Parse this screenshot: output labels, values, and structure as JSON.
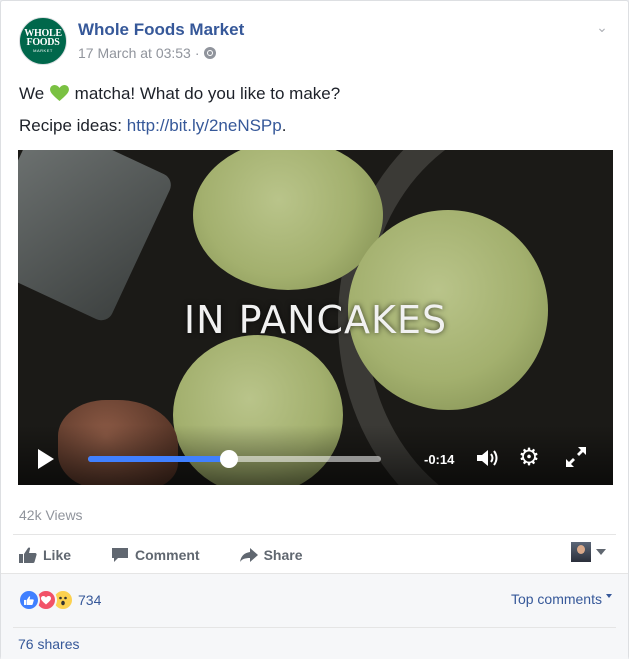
{
  "post": {
    "page_name": "Whole Foods Market",
    "timestamp": "17 March at 03:53",
    "separator": "·",
    "privacy_icon": "globe-icon",
    "logo": {
      "line1": "WHOLE",
      "line2": "FOODS",
      "line3": "MARKET"
    },
    "text_line1_before": "We",
    "text_line1_after": "matcha! What do you like to make?",
    "text_line2_label": "Recipe ideas:",
    "text_line2_link": "http://bit.ly/2neNSPp",
    "text_line2_end": "."
  },
  "video": {
    "caption": "IN PANCAKES",
    "time_remaining": "-0:14",
    "progress": 0.48
  },
  "stats": {
    "views": "42k Views",
    "reaction_count": "734",
    "shares": "76 shares",
    "top_comments": "Top comments"
  },
  "actions": {
    "like": "Like",
    "comment": "Comment",
    "share": "Share"
  },
  "colors": {
    "link": "#365899",
    "progress": "#4080ff",
    "brand_green": "#00674b"
  }
}
